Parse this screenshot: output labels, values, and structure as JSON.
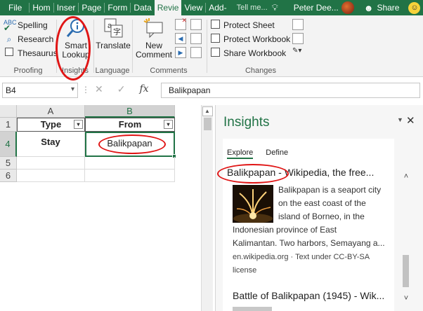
{
  "tabs": [
    "File",
    "Hom",
    "Inser",
    "Page",
    "Form",
    "Data",
    "Revie",
    "View",
    "Add-"
  ],
  "active_tab": "Revie",
  "tell_me": "Tell me...",
  "user_name": "Peter Dee...",
  "share_label": "Share",
  "ribbon": {
    "proofing": {
      "label": "Proofing",
      "spelling": "Spelling",
      "research": "Research",
      "thesaurus": "Thesaurus"
    },
    "insights": {
      "label": "Insights",
      "smart_lookup_line1": "Smart",
      "smart_lookup_line2": "Lookup"
    },
    "language": {
      "label": "Language",
      "translate": "Translate"
    },
    "comments": {
      "label": "Comments",
      "new_comment_line1": "New",
      "new_comment_line2": "Comment"
    },
    "changes": {
      "label": "Changes",
      "protect_sheet": "Protect Sheet",
      "protect_workbook": "Protect Workbook",
      "share_workbook": "Share Workbook"
    }
  },
  "formula_bar": {
    "name_box": "B4",
    "fx": "fx",
    "value": "Balikpapan"
  },
  "sheet": {
    "columns": [
      "A",
      "B"
    ],
    "selected_column": "B",
    "rows": [
      "1",
      "4",
      "5",
      "6"
    ],
    "selected_row": "4",
    "header_row": [
      "Type",
      "From"
    ],
    "data_row": [
      "Stay",
      "Balikpapan"
    ]
  },
  "insights": {
    "title": "Insights",
    "tabs": [
      "Explore",
      "Define"
    ],
    "result1_title": "Balikpapan - Wikipedia, the free...",
    "result1_text_lines": [
      "Balikpapan is a seaport city",
      "on the east coast of the",
      "island of Borneo, in the"
    ],
    "result1_text_full": [
      "Indonesian province of East",
      "Kalimantan. Two harbors, Semayang a..."
    ],
    "result1_source": "en.wikipedia.org · Text under CC-BY-SA license",
    "result2_title": "Battle of Balikpapan (1945) - Wik..."
  },
  "colors": {
    "excel_green": "#217346",
    "annotation_red": "#e01515"
  }
}
